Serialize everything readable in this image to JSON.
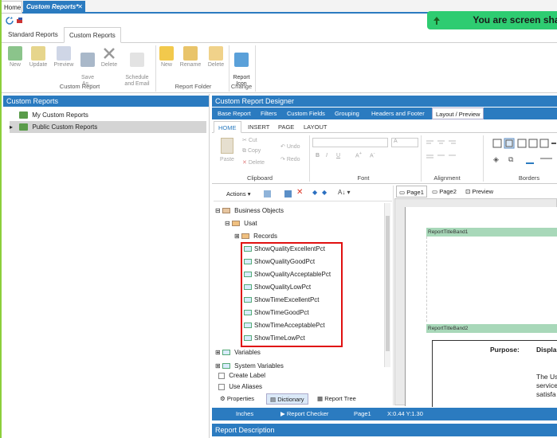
{
  "window_tabs": {
    "home": "Home",
    "custom_reports": "Custom Reports*",
    "close": "✕"
  },
  "banner": {
    "text": "You are screen shar"
  },
  "ribbon_tabs": {
    "standard": "Standard Reports",
    "custom": "Custom Reports"
  },
  "ribbon": {
    "new": "New",
    "update": "Update",
    "preview": "Preview",
    "save_as": "Save\nAs...",
    "delete": "Delete",
    "schedule": "Schedule\nand Email",
    "group_custom_report": "Custom Report",
    "folder_new": "New",
    "folder_rename": "Rename",
    "folder_delete": "Delete",
    "group_report_folder": "Report Folder",
    "report_icon": "Report\nIcon",
    "group_change": "Change"
  },
  "left_panel": {
    "title": "Custom Reports",
    "items": [
      "My Custom Reports",
      "Public Custom Reports"
    ]
  },
  "designer": {
    "title": "Custom Report Designer",
    "tabs": [
      "Base Report",
      "Filters",
      "Custom Fields",
      "Grouping",
      "Headers and Footer",
      "Layout / Preview"
    ],
    "sub_tabs": [
      "HOME",
      "INSERT",
      "PAGE",
      "LAYOUT"
    ],
    "clipboard": {
      "paste": "Paste",
      "cut": "Cut",
      "copy": "Copy",
      "delete": "Delete",
      "undo": "Undo",
      "redo": "Redo",
      "label": "Clipboard"
    },
    "font": {
      "b": "B",
      "i": "I",
      "u": "U",
      "label": "Font",
      "size_a": "A"
    },
    "alignment": {
      "label": "Alignment"
    },
    "borders": {
      "label": "Borders"
    }
  },
  "dictionary": {
    "actions": "Actions",
    "tree": {
      "business_objects": "Business Objects",
      "usat": "Usat",
      "records": "Records",
      "fields": [
        "ShowQualityExcellentPct",
        "ShowQualityGoodPct",
        "ShowQualityAcceptablePct",
        "ShowQualityLowPct",
        "ShowTimeExcellentPct",
        "ShowTimeGoodPct",
        "ShowTimeAcceptablePct",
        "ShowTimeLowPct"
      ],
      "variables": "Variables",
      "system_variables": "System Variables"
    },
    "create_label": "Create Label",
    "use_aliases": "Use Aliases",
    "bottom_tabs": [
      "Properties",
      "Dictionary",
      "Report Tree"
    ]
  },
  "preview": {
    "tabs": [
      "Page1",
      "Page2",
      "Preview"
    ],
    "band1": "ReportTitleBand1",
    "band2": "ReportTitleBand2",
    "purpose": "Purpose:",
    "display": "Displa",
    "body_lines": [
      "The Us",
      "service",
      "satisfa"
    ]
  },
  "status": {
    "units": "Inches",
    "checker": "Report Checker",
    "page": "Page1",
    "coords": "X:0.44  Y:1.30"
  },
  "report_description": "Report Description",
  "colors": {
    "accent": "#2b7bc0",
    "banner": "#2ecc71",
    "highlight": "#e01010",
    "band": "#a8d8b9"
  }
}
